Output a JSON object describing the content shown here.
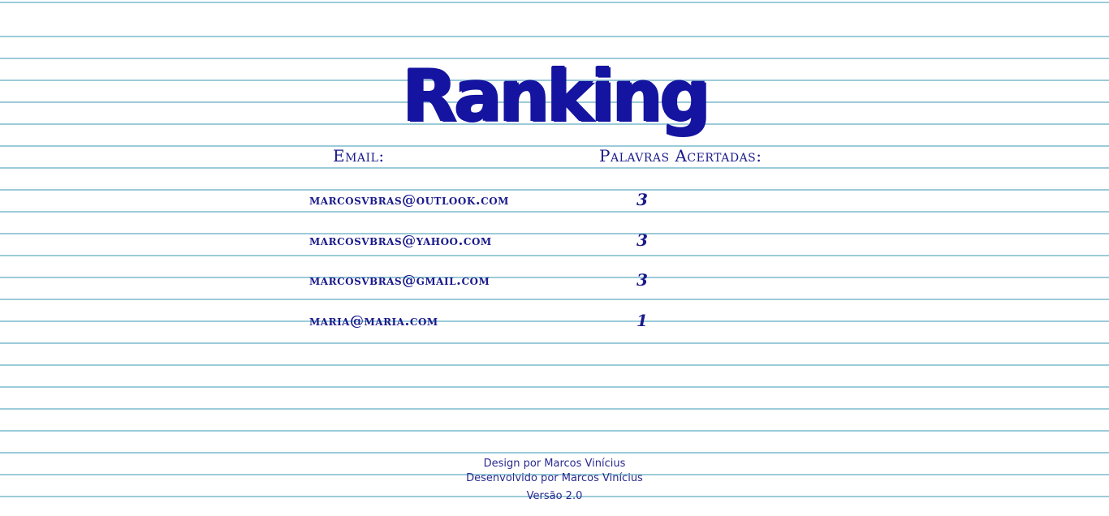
{
  "page": {
    "title": "Ranking"
  },
  "table": {
    "headers": {
      "email": "Email:",
      "words": "Palavras Acertadas:"
    },
    "rows": [
      {
        "email": "marcosvbras@outlook.com",
        "score": "3"
      },
      {
        "email": "marcosvbras@yahoo.com",
        "score": "3"
      },
      {
        "email": "marcosvbras@gmail.com",
        "score": "3"
      },
      {
        "email": "maria@maria.com",
        "score": "1"
      }
    ]
  },
  "footer": {
    "design": "Design por Marcos Vinícius",
    "developed": "Desenvolvido por Marcos Vinícius",
    "version": "Versão 2.0"
  },
  "colors": {
    "ink": "#1a1a8c",
    "ruled_line": "#9ccbd9",
    "paper": "#ffffff"
  }
}
